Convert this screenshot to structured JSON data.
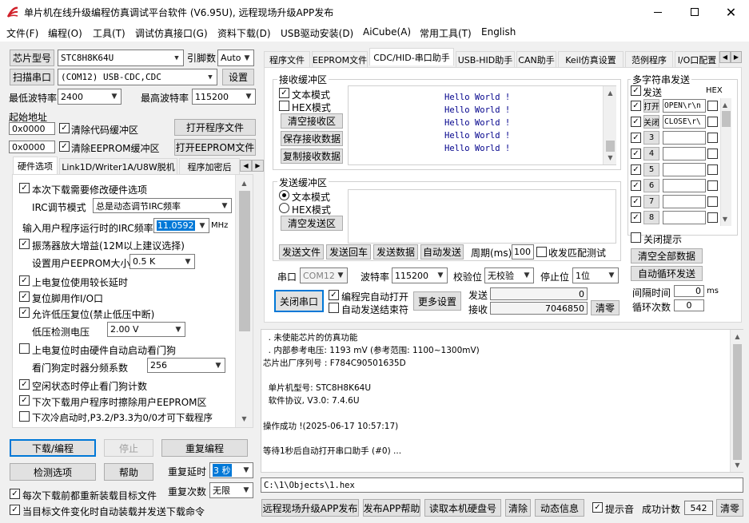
{
  "window": {
    "title": "单片机在线升级编程仿真调试平台软件 (V6.95U), 远程现场升级APP发布"
  },
  "menu": [
    "文件(F)",
    "编程(O)",
    "工具(T)",
    "调试仿真接口(G)",
    "资料下载(D)",
    "USB驱动安装(D)",
    "AiCube(A)",
    "常用工具(T)",
    "English"
  ],
  "left": {
    "chip_btn": "芯片型号",
    "chip": "STC8H8K64U",
    "pins_label": "引脚数",
    "pins": "Auto",
    "scan_btn": "扫描串口",
    "port": "(COM12) USB-CDC,CDC",
    "settings_btn": "设置",
    "min_baud_label": "最低波特率",
    "min_baud": "2400",
    "max_baud_label": "最高波特率",
    "max_baud": "115200",
    "start_addr_label": "起始地址",
    "addr1": "0x0000",
    "clear_code": "清除代码缓冲区",
    "open_prog": "打开程序文件",
    "addr2": "0x0000",
    "clear_eeprom": "清除EEPROM缓冲区",
    "open_eeprom": "打开EEPROM文件",
    "tabs": [
      "硬件选项",
      "Link1D/Writer1A/U8W脱机",
      "程序加密后"
    ],
    "hw": {
      "opt1": "本次下载需要修改硬件选项",
      "irc_mode_label": "IRC调节模式",
      "irc_mode": "总是动态调节IRC频率",
      "irc_freq_label": "输入用户程序运行时的IRC频率",
      "irc_freq": "11.0592",
      "mhz": "MHz",
      "opt2": "振荡器放大增益(12M以上建议选择)",
      "eeprom_size_label": "设置用户EEPROM大小",
      "eeprom_size": "0.5 K",
      "opt3": "上电复位使用较长延时",
      "opt4": "复位脚用作I/O口",
      "opt5": "允许低压复位(禁止低压中断)",
      "lvd_label": "低压检测电压",
      "lvd": "2.00 V",
      "opt6": "上电复位时由硬件自动启动看门狗",
      "wdt_label": "看门狗定时器分频系数",
      "wdt": "256",
      "opt7": "空闲状态时停止看门狗计数",
      "opt8": "下次下载用户程序时擦除用户EEPROM区",
      "opt9": "下次冷启动时,P3.2/P3.3为0/0才可下载程序"
    },
    "download_btn": "下载/编程",
    "stop_btn": "停止",
    "reprog_btn": "重复编程",
    "check_btn": "检测选项",
    "help_btn": "帮助",
    "repeat_delay_label": "重复延时",
    "repeat_delay": "3 秒",
    "repeat_count_label": "重复次数",
    "repeat_count": "无限",
    "reload_each": "每次下载前都重新装载目标文件",
    "auto_send": "当目标文件变化时自动装载并发送下载命令"
  },
  "right_tabs": [
    "程序文件",
    "EEPROM文件",
    "CDC/HID-串口助手",
    "USB-HID助手",
    "CAN助手",
    "Keil仿真设置",
    "范例程序",
    "I/O口配置"
  ],
  "serial": {
    "recv_title": "接收缓冲区",
    "text_mode": "文本模式",
    "hex_mode": "HEX模式",
    "clear_recv": "清空接收区",
    "save_recv": "保存接收数据",
    "copy_recv": "复制接收数据",
    "recv_lines": [
      "Hello World !",
      "Hello World !",
      "Hello World !",
      "Hello World !",
      "Hello World !"
    ],
    "send_title": "发送缓冲区",
    "clear_send": "清空发送区",
    "send_file": "发送文件",
    "send_return": "发送回车",
    "send_data": "发送数据",
    "auto_send": "自动发送",
    "period_label": "周期(ms)",
    "period": "100",
    "match_test": "收发匹配测试",
    "port_label": "串口",
    "port": "COM12",
    "baud_label": "波特率",
    "baud": "115200",
    "parity_label": "校验位",
    "parity": "无校验",
    "stop_label": "停止位",
    "stop": "1位",
    "close_port": "关闭串口",
    "auto_open": "编程完自动打开",
    "auto_end": "自动发送结束符",
    "more": "更多设置",
    "send_label": "发送",
    "send_count": "0",
    "recv_label": "接收",
    "recv_count": "7046850",
    "clear_counts": "清零"
  },
  "multi": {
    "title": "多字符串发送",
    "send_hdr": "发送",
    "hex_hdr": "HEX",
    "rows": [
      {
        "btn": "打开",
        "val": "OPEN\\r\\n"
      },
      {
        "btn": "关闭",
        "val": "CLOSE\\r\\"
      },
      {
        "btn": "3",
        "val": ""
      },
      {
        "btn": "4",
        "val": ""
      },
      {
        "btn": "5",
        "val": ""
      },
      {
        "btn": "6",
        "val": ""
      },
      {
        "btn": "7",
        "val": ""
      },
      {
        "btn": "8",
        "val": ""
      }
    ],
    "close_hint": "关闭提示",
    "clear_all": "清空全部数据",
    "auto_loop": "自动循环发送",
    "interval_label": "间隔时间",
    "interval": "0",
    "ms": "ms",
    "loop_label": "循环次数",
    "loop": "0"
  },
  "log": [
    "  . 未使能芯片的仿真功能",
    "  . 内部参考电压: 1193 mV (参考范围: 1100~1300mV)",
    "芯片出厂序列号 : F784C90501635D",
    "",
    "  单片机型号: STC8H8K64U",
    "  软件协议, V3.0: 7.4.6U",
    "",
    "操作成功 !(2025-06-17 10:57:17)",
    "",
    "等待1秒后自动打开串口助手 (#0) ..."
  ],
  "filepath": "C:\\1\\Objects\\1.hex",
  "bottom": {
    "remote": "远程现场升级APP发布",
    "publish_help": "发布APP帮助",
    "read_disk": "读取本机硬盘号",
    "clear": "清除",
    "dynamic": "动态信息",
    "beep": "提示音",
    "success_label": "成功计数",
    "success": "542",
    "clear2": "清零"
  }
}
